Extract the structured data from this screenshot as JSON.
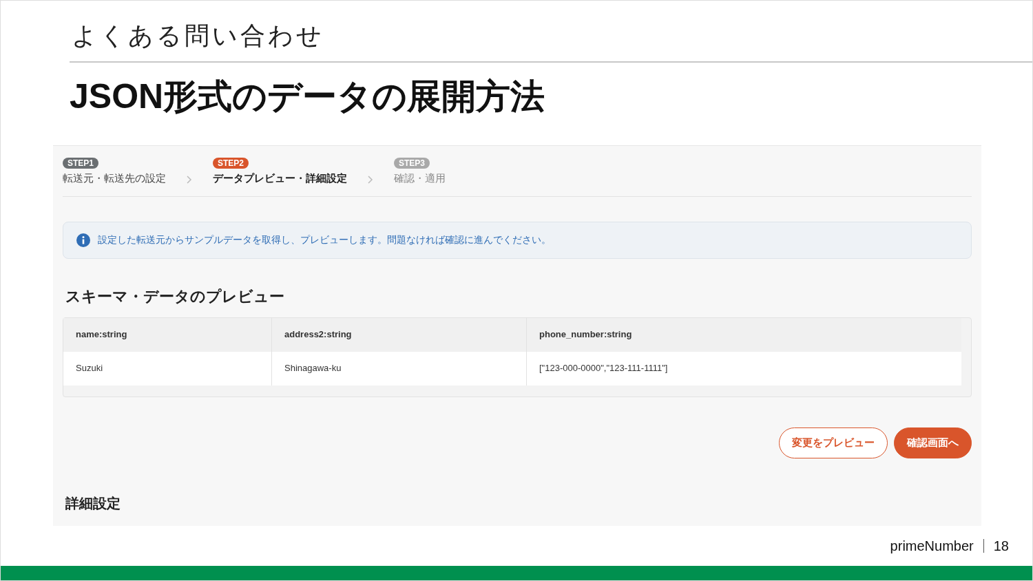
{
  "slide": {
    "section": "よくある問い合わせ",
    "title": "JSON形式のデータの展開方法"
  },
  "app": {
    "steps": [
      {
        "badge": "STEP1",
        "label": "転送元・転送先の設定",
        "completed": true,
        "selected": false
      },
      {
        "badge": "STEP2",
        "label": "データプレビュー・詳細設定",
        "completed": false,
        "selected": true
      },
      {
        "badge": "STEP3",
        "label": "確認・適用",
        "completed": false,
        "selected": false
      }
    ],
    "info": "設定した転送元からサンプルデータを取得し、プレビューします。問題なければ確認に進んでください。",
    "preview_heading": "スキーマ・データのプレビュー",
    "table": {
      "columns": [
        "name:string",
        "address2:string",
        "phone_number:string"
      ],
      "rows": [
        [
          "Suzuki",
          "Shinagawa-ku",
          "[\"123-000-0000\",\"123-111-1111\"]"
        ]
      ]
    },
    "buttons": [
      {
        "label": "変更をプレビュー",
        "kind": "outline"
      },
      {
        "label": "確認画面へ",
        "kind": "primary"
      }
    ],
    "details_heading": "詳細設定"
  },
  "footer": {
    "brand": "primeNumber",
    "page": "18"
  }
}
